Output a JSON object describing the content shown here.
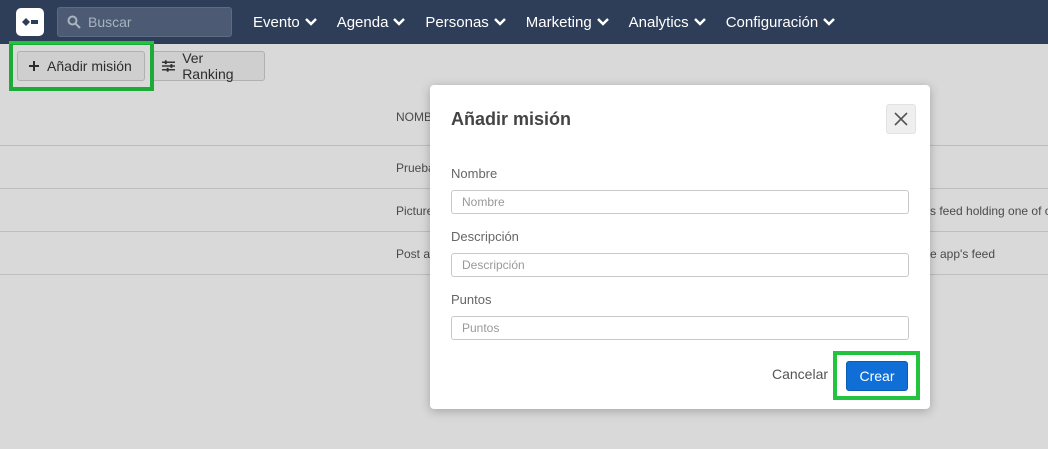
{
  "search": {
    "placeholder": "Buscar"
  },
  "nav": {
    "items": [
      {
        "label": "Evento"
      },
      {
        "label": "Agenda"
      },
      {
        "label": "Personas"
      },
      {
        "label": "Marketing"
      },
      {
        "label": "Analytics"
      },
      {
        "label": "Configuración"
      }
    ]
  },
  "toolbar": {
    "add_label": "Añadir misión",
    "ranking_label": "Ver Ranking"
  },
  "table": {
    "header": "NOMB",
    "rows": [
      {
        "name": "Prueba",
        "desc": ""
      },
      {
        "name": "Picture",
        "desc": "s feed holding one of o"
      },
      {
        "name": "Post a",
        "desc": "e app's feed"
      }
    ]
  },
  "modal": {
    "title": "Añadir misión",
    "fields": [
      {
        "label": "Nombre",
        "placeholder": "Nombre"
      },
      {
        "label": "Descripción",
        "placeholder": "Descripción"
      },
      {
        "label": "Puntos",
        "placeholder": "Puntos"
      }
    ],
    "cancel_label": "Cancelar",
    "submit_label": "Crear"
  },
  "colors": {
    "topbar": "#2e3e58",
    "primary": "#0f6fd6",
    "highlight": "#22c33f"
  }
}
